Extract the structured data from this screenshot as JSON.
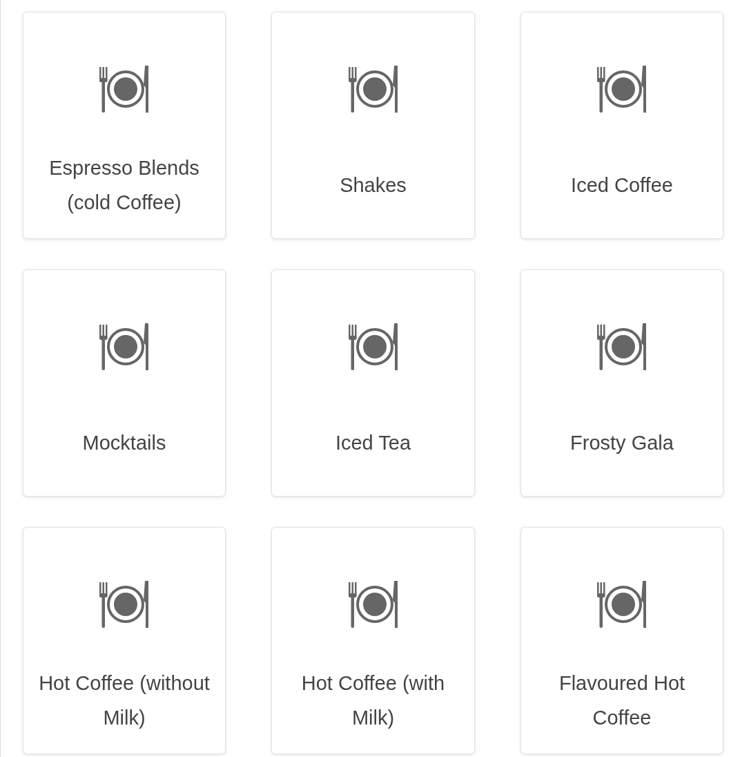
{
  "categories": [
    {
      "label": "Espresso Blends (cold Coffee)"
    },
    {
      "label": "Shakes"
    },
    {
      "label": "Iced Coffee"
    },
    {
      "label": "Mocktails"
    },
    {
      "label": "Iced Tea"
    },
    {
      "label": "Frosty Gala"
    },
    {
      "label": "Hot Coffee (without Milk)"
    },
    {
      "label": "Hot Coffee (with Milk)"
    },
    {
      "label": "Flavoured Hot Coffee"
    }
  ]
}
